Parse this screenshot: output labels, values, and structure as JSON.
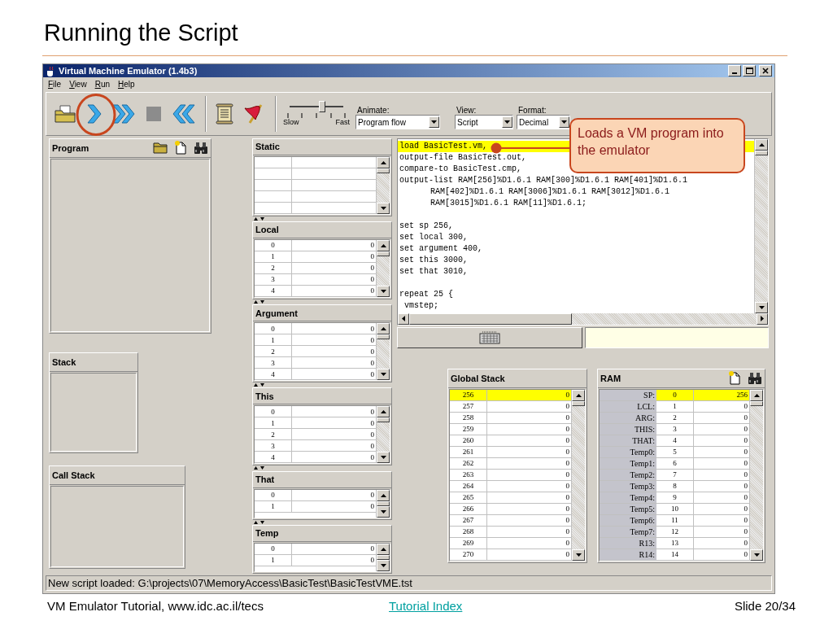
{
  "slide": {
    "title": "Running the Script",
    "callout": "Loads a VM program into the emulator",
    "footer": {
      "source": "VM Emulator Tutorial, www.idc.ac.il/tecs",
      "link": "Tutorial Index",
      "page": "Slide 20/34"
    }
  },
  "window": {
    "title": "Virtual Machine Emulator (1.4b3)",
    "menu": [
      "File",
      "View",
      "Run",
      "Help"
    ],
    "toolbar": {
      "speed": {
        "level": 0.6,
        "min_label": "Slow",
        "max_label": "Fast"
      },
      "dropdowns": [
        {
          "label": "Animate:",
          "value": "Program flow"
        },
        {
          "label": "View:",
          "value": "Script"
        },
        {
          "label": "Format:",
          "value": "Decimal"
        }
      ]
    },
    "program": {
      "title": "Program"
    },
    "stack": {
      "title": "Stack"
    },
    "call_stack": {
      "title": "Call Stack"
    },
    "segments": [
      {
        "title": "Static"
      },
      {
        "title": "Local",
        "rows": [
          {
            "index": "0",
            "value": "0"
          },
          {
            "index": "1",
            "value": "0"
          },
          {
            "index": "2",
            "value": "0"
          },
          {
            "index": "3",
            "value": "0"
          },
          {
            "index": "4",
            "value": "0"
          }
        ]
      },
      {
        "title": "Argument",
        "rows": [
          {
            "index": "0",
            "value": "0"
          },
          {
            "index": "1",
            "value": "0"
          },
          {
            "index": "2",
            "value": "0"
          },
          {
            "index": "3",
            "value": "0"
          },
          {
            "index": "4",
            "value": "0"
          }
        ]
      },
      {
        "title": "This",
        "rows": [
          {
            "index": "0",
            "value": "0"
          },
          {
            "index": "1",
            "value": "0"
          },
          {
            "index": "2",
            "value": "0"
          },
          {
            "index": "3",
            "value": "0"
          },
          {
            "index": "4",
            "value": "0"
          }
        ]
      },
      {
        "title": "That",
        "rows": [
          {
            "index": "0",
            "value": "0"
          },
          {
            "index": "1",
            "value": "0"
          }
        ]
      },
      {
        "title": "Temp",
        "rows": [
          {
            "index": "0",
            "value": "0"
          },
          {
            "index": "1",
            "value": "0"
          }
        ]
      }
    ],
    "script": {
      "lines": [
        {
          "kind": "command",
          "text": "load BasicTest.vm,",
          "selected": true
        },
        {
          "kind": "command",
          "text": "output-file BasicTest.out,",
          "selected": false
        },
        {
          "kind": "command",
          "text": "compare-to BasicTest.cmp,",
          "selected": false
        },
        {
          "kind": "command",
          "text": "output-list RAM[256]%D1.6.1 RAM[300]%D1.6.1 RAM[401]%D1.6.1",
          "selected": false
        },
        {
          "kind": "continuation",
          "text": "RAM[402]%D1.6.1 RAM[3006]%D1.6.1 RAM[3012]%D1.6.1",
          "selected": false
        },
        {
          "kind": "continuation",
          "text": "RAM[3015]%D1.6.1 RAM[11]%D1.6.1;",
          "selected": false
        },
        {
          "kind": "blank",
          "selected": false
        },
        {
          "kind": "command",
          "text": "set sp 256,",
          "selected": false
        },
        {
          "kind": "command",
          "text": "set local 300,",
          "selected": false
        },
        {
          "kind": "command",
          "text": "set argument 400,",
          "selected": false
        },
        {
          "kind": "command",
          "text": "set this 3000,",
          "selected": false
        },
        {
          "kind": "command",
          "text": "set that 3010,",
          "selected": false
        },
        {
          "kind": "blank",
          "selected": false
        },
        {
          "kind": "command",
          "text": "repeat 25 {",
          "selected": false
        },
        {
          "kind": "command",
          "text": " vmstep;",
          "selected": false
        }
      ]
    },
    "global_stack": {
      "title": "Global Stack",
      "rows": [
        {
          "address": "256",
          "value": "0",
          "selected": true
        },
        {
          "address": "257",
          "value": "0",
          "selected": false
        },
        {
          "address": "258",
          "value": "0",
          "selected": false
        },
        {
          "address": "259",
          "value": "0",
          "selected": false
        },
        {
          "address": "260",
          "value": "0",
          "selected": false
        },
        {
          "address": "261",
          "value": "0",
          "selected": false
        },
        {
          "address": "262",
          "value": "0",
          "selected": false
        },
        {
          "address": "263",
          "value": "0",
          "selected": false
        },
        {
          "address": "264",
          "value": "0",
          "selected": false
        },
        {
          "address": "265",
          "value": "0",
          "selected": false
        },
        {
          "address": "266",
          "value": "0",
          "selected": false
        },
        {
          "address": "267",
          "value": "0",
          "selected": false
        },
        {
          "address": "268",
          "value": "0",
          "selected": false
        },
        {
          "address": "269",
          "value": "0",
          "selected": false
        },
        {
          "address": "270",
          "value": "0",
          "selected": false
        }
      ]
    },
    "ram": {
      "title": "RAM",
      "rows": [
        {
          "label": "SP:",
          "address": "0",
          "value": "256",
          "selected": true
        },
        {
          "label": "LCL:",
          "address": "1",
          "value": "0",
          "selected": false
        },
        {
          "label": "ARG:",
          "address": "2",
          "value": "0",
          "selected": false
        },
        {
          "label": "THIS:",
          "address": "3",
          "value": "0",
          "selected": false
        },
        {
          "label": "THAT:",
          "address": "4",
          "value": "0",
          "selected": false
        },
        {
          "label": "Temp0:",
          "address": "5",
          "value": "0",
          "selected": false
        },
        {
          "label": "Temp1:",
          "address": "6",
          "value": "0",
          "selected": false
        },
        {
          "label": "Temp2:",
          "address": "7",
          "value": "0",
          "selected": false
        },
        {
          "label": "Temp3:",
          "address": "8",
          "value": "0",
          "selected": false
        },
        {
          "label": "Temp4:",
          "address": "9",
          "value": "0",
          "selected": false
        },
        {
          "label": "Temp5:",
          "address": "10",
          "value": "0",
          "selected": false
        },
        {
          "label": "Temp6:",
          "address": "11",
          "value": "0",
          "selected": false
        },
        {
          "label": "Temp7:",
          "address": "12",
          "value": "0",
          "selected": false
        },
        {
          "label": "R13:",
          "address": "13",
          "value": "0",
          "selected": false
        },
        {
          "label": "R14:",
          "address": "14",
          "value": "0",
          "selected": false
        }
      ]
    },
    "status": "New script loaded: G:\\projects\\07\\MemoryAccess\\BasicTest\\BasicTestVME.tst"
  }
}
